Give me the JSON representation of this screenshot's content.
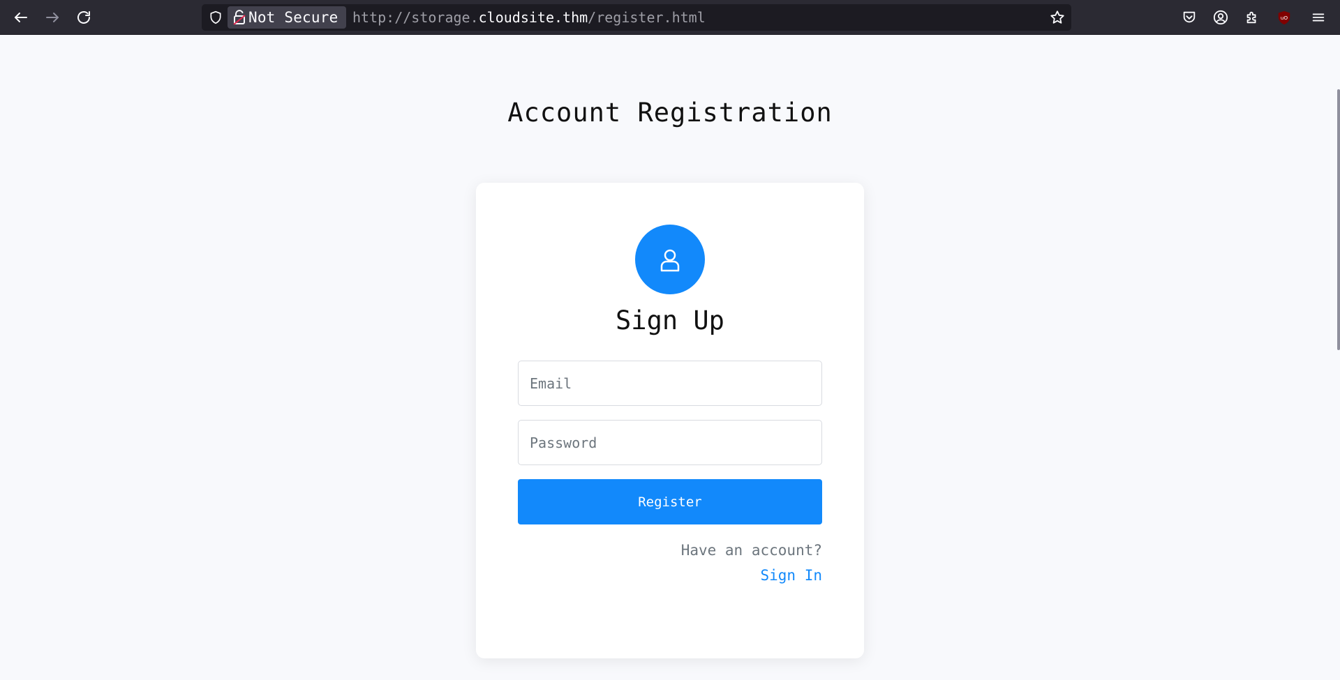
{
  "browser": {
    "security_label": "Not Secure",
    "url_scheme": "http://",
    "url_subdomain": "storage.",
    "url_host": "cloudsite.thm",
    "url_path": "/register.html",
    "icons": {
      "back": "arrow-left-icon",
      "forward": "arrow-right-icon",
      "reload": "reload-icon",
      "shield": "shield-icon",
      "lock": "broken-lock-icon",
      "bookmark": "star-icon",
      "pocket": "pocket-icon",
      "account": "account-icon",
      "extensions": "puzzle-icon",
      "ublock": "ublock-origin-icon",
      "menu": "hamburger-menu-icon"
    }
  },
  "page": {
    "title": "Account Registration",
    "card": {
      "heading": "Sign Up",
      "avatar_icon": "user-icon",
      "email_placeholder": "Email",
      "password_placeholder": "Password",
      "register_label": "Register",
      "have_account_text": "Have an account?",
      "signin_label": "Sign In"
    }
  },
  "colors": {
    "accent": "#1289fb",
    "page_bg": "#f8f9fc",
    "toolbar_bg": "#2b2a33",
    "muted_text": "#6c757d",
    "ublock_red": "#800000"
  }
}
